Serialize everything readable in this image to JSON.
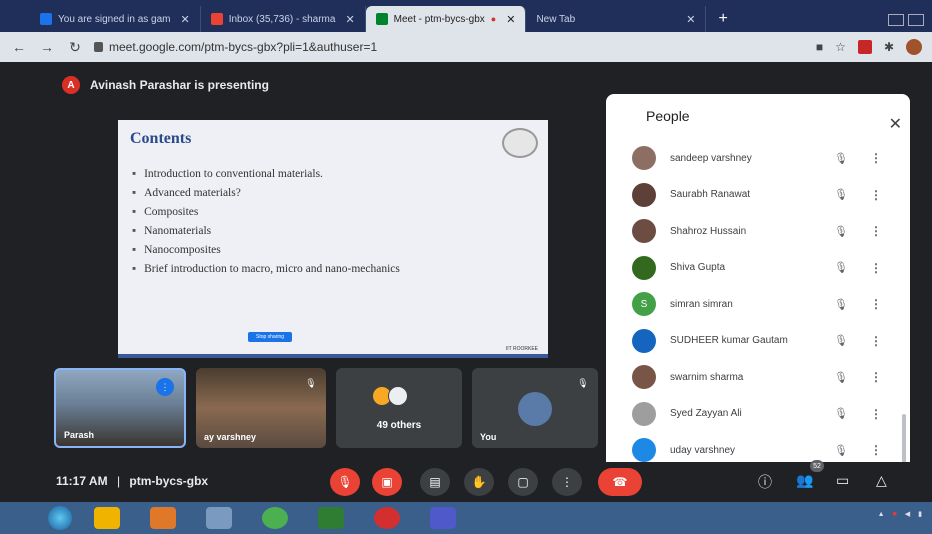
{
  "browser": {
    "tabs": [
      {
        "label": "You are signed in as gam",
        "favicon_color": "#1a73e8",
        "active": false
      },
      {
        "label": "Inbox (35,736) - sharma",
        "favicon_color": "#ea4335",
        "active": false
      },
      {
        "label": "Meet - ptm-bycs-gbx",
        "favicon_color": "#00832d",
        "active": true
      },
      {
        "label": "New Tab",
        "favicon_color": "",
        "active": false
      }
    ],
    "url": "meet.google.com/ptm-bycs-gbx?pli=1&authuser=1"
  },
  "meet": {
    "presenter_initial": "A",
    "presenter_banner": "Avinash Parashar is presenting",
    "slide": {
      "title": "Contents",
      "bullets": [
        "Introduction to conventional materials.",
        "Advanced materials?",
        "Composites",
        "Nanomaterials",
        "Nanocomposites",
        "Brief introduction to macro, micro and nano-mechanics"
      ],
      "share_button": "Stop sharing",
      "footer": "IIT ROORKEE"
    },
    "tiles": [
      {
        "label": "Parash"
      },
      {
        "label": "ay varshney"
      },
      {
        "label": "49 others"
      },
      {
        "label": "You"
      }
    ],
    "people_panel": {
      "title": "People",
      "participants": [
        {
          "name": "sandeep varshney",
          "avatar_color": "#8d6e63",
          "initial": ""
        },
        {
          "name": "Saurabh Ranawat",
          "avatar_color": "#5d4037",
          "initial": ""
        },
        {
          "name": "Shahroz Hussain",
          "avatar_color": "#6d4c41",
          "initial": ""
        },
        {
          "name": "Shiva Gupta",
          "avatar_color": "#33691e",
          "initial": ""
        },
        {
          "name": "simran simran",
          "avatar_color": "#43a047",
          "initial": "S"
        },
        {
          "name": "SUDHEER kumar Gautam",
          "avatar_color": "#1565c0",
          "initial": ""
        },
        {
          "name": "swarnim sharma",
          "avatar_color": "#795548",
          "initial": ""
        },
        {
          "name": "Syed Zayyan Ali",
          "avatar_color": "#9e9e9e",
          "initial": ""
        },
        {
          "name": "uday varshney",
          "avatar_color": "#1e88e5",
          "initial": ""
        }
      ]
    },
    "bottom_bar": {
      "time": "11:17 AM",
      "separator": "|",
      "meeting_code": "ptm-bycs-gbx",
      "people_count": "52"
    }
  }
}
